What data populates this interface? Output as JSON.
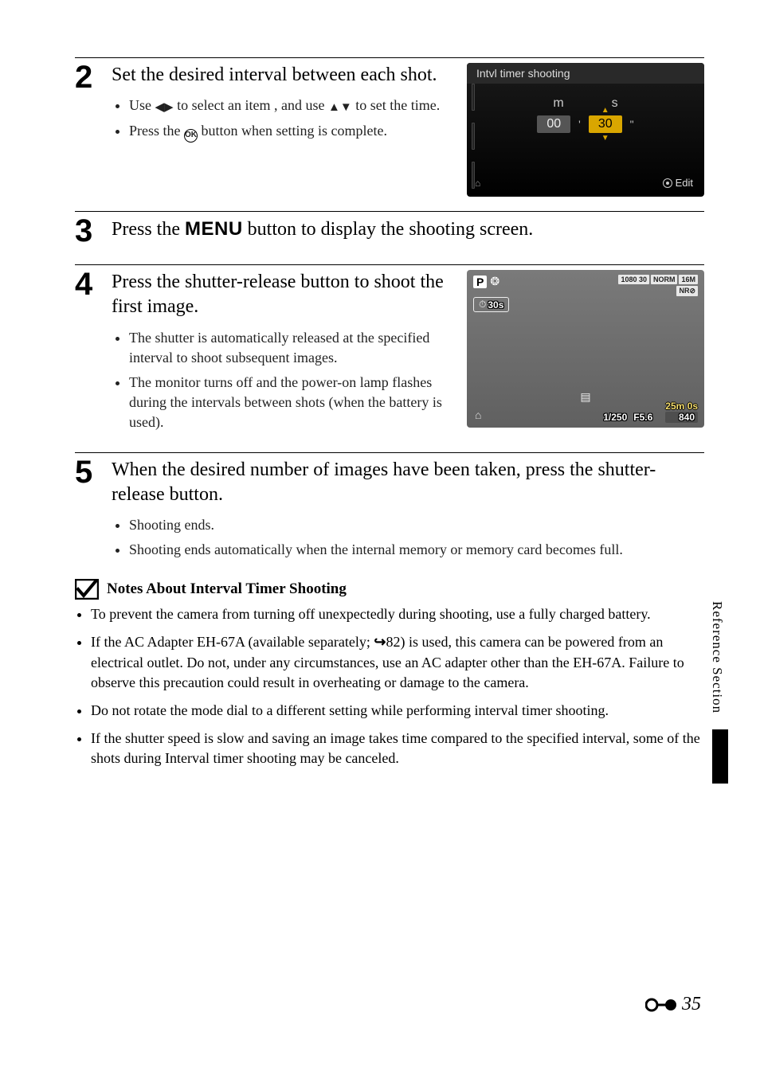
{
  "steps": {
    "s2": {
      "num": "2",
      "title": "Set the desired interval between each shot.",
      "b1a": "Use ",
      "b1b": " to select an item , and use ",
      "b1c": " to set the time.",
      "b2a": "Press the ",
      "b2b": " button when setting is complete."
    },
    "s3": {
      "num": "3",
      "title_a": "Press the ",
      "title_menu": "MENU",
      "title_b": " button to display the shooting screen."
    },
    "s4": {
      "num": "4",
      "title": "Press the shutter-release button to shoot the first image.",
      "b1": "The shutter is automatically released at the specified interval to shoot subsequent images.",
      "b2": "The monitor turns off and the power-on lamp flashes during the intervals between shots (when the battery is used)."
    },
    "s5": {
      "num": "5",
      "title": "When the desired number of images have been taken, press the shutter-release button.",
      "b1": "Shooting ends.",
      "b2": "Shooting ends automatically when the internal memory or memory card becomes full."
    }
  },
  "lcd1": {
    "title": "Intvl timer shooting",
    "col_m": "m",
    "col_s": "s",
    "val_m": "00",
    "val_s": "30",
    "edit": "Edit"
  },
  "lcd2": {
    "mode": "P",
    "badge1": "1080 30",
    "badge2": "NORM",
    "badge3": "16M",
    "badge_nr": "NR⊘",
    "interval": "30s",
    "shutter": "1/250",
    "aperture": "F5.6",
    "time": "25m 0s",
    "remaining": "840"
  },
  "notes": {
    "heading": "Notes About Interval Timer Shooting",
    "n1": "To prevent the camera from turning off unexpectedly during shooting, use a fully charged battery.",
    "n2a": "If the AC Adapter EH-67A (available separately; ",
    "n2b": "82) is used, this camera can be powered from an electrical outlet. Do not, under any circumstances, use an AC adapter other than the EH-67A. Failure to observe this precaution could result in overheating or damage to the camera.",
    "n3": "Do not rotate the mode dial to a different setting while performing interval timer shooting.",
    "n4": "If the shutter speed is slow and saving an image takes time compared to the specified interval, some of the shots during Interval timer shooting may be canceled."
  },
  "side_tab": "Reference Section",
  "page_number": "35"
}
